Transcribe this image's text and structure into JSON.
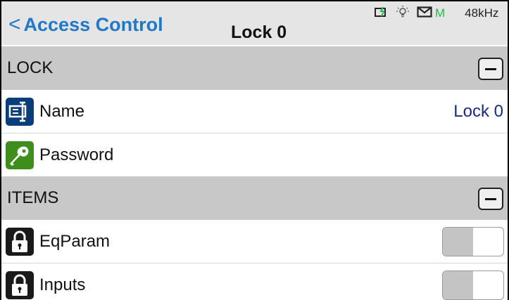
{
  "header": {
    "back_label": "Access Control",
    "title": "Lock 0",
    "status": {
      "icons": [
        "battery-charging-icon",
        "light-bulb-icon",
        "mail-icon"
      ],
      "mode": "M",
      "sample_rate": "48kHz"
    }
  },
  "sections": [
    {
      "label": "LOCK",
      "rows": [
        {
          "label": "Name",
          "value": "Lock 0",
          "icon": "name-tag-icon"
        },
        {
          "label": "Password",
          "value": "",
          "icon": "key-icon"
        }
      ]
    },
    {
      "label": "ITEMS",
      "rows": [
        {
          "label": "EqParam",
          "icon": "padlock-icon",
          "locked": false
        },
        {
          "label": "Inputs",
          "icon": "padlock-icon",
          "locked": false
        }
      ]
    }
  ],
  "colors": {
    "accent": "#1f78c8",
    "header_bg": "#e5e5e5",
    "section_bg": "#c8c8c8",
    "value_text": "#1a2a8a",
    "status_green": "#2db84b"
  }
}
